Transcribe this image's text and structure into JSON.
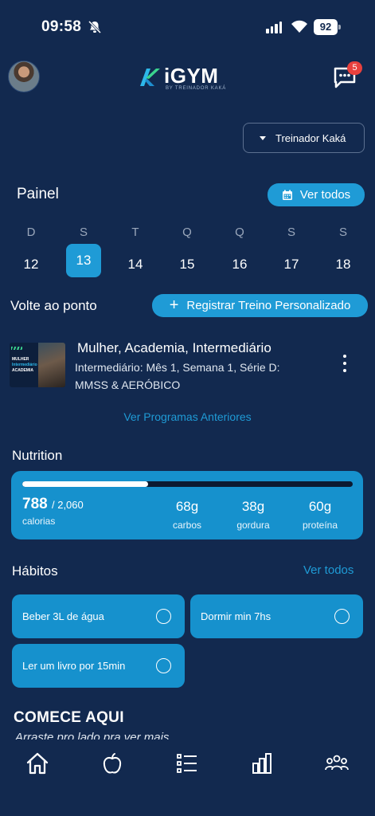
{
  "status_bar": {
    "time": "09:58",
    "battery": "92"
  },
  "header": {
    "logo_text": "iGYM",
    "logo_subtitle": "BY TREINADOR KAKÁ",
    "messages_badge": "5"
  },
  "trainer_select": {
    "selected": "Treinador Kaká"
  },
  "painel": {
    "title": "Painel",
    "ver_todos": "Ver todos",
    "days": [
      {
        "letter": "D",
        "num": "12"
      },
      {
        "letter": "S",
        "num": "13",
        "active": true
      },
      {
        "letter": "T",
        "num": "14"
      },
      {
        "letter": "Q",
        "num": "15"
      },
      {
        "letter": "Q",
        "num": "16"
      },
      {
        "letter": "S",
        "num": "17"
      },
      {
        "letter": "S",
        "num": "18"
      }
    ]
  },
  "volte": {
    "title": "Volte ao ponto",
    "register_button": "Registrar Treino Personalizado"
  },
  "program": {
    "thumb_line1": "MULHER",
    "thumb_line2": "Intermediário",
    "thumb_line3": "ACADEMIA",
    "title": "Mulher, Academia, Intermediário",
    "subtitle": "Intermediário: Mês 1, Semana 1, Série D: MMSS & AERÓBICO",
    "prev_link": "Ver Programas Anteriores"
  },
  "nutrition": {
    "title": "Nutrition",
    "calories": "788",
    "calories_goal": "/ 2,060",
    "calories_label": "calorias",
    "progress_fraction": 0.38,
    "macros": [
      {
        "value": "68g",
        "label": "carbos"
      },
      {
        "value": "38g",
        "label": "gordura"
      },
      {
        "value": "60g",
        "label": "proteína"
      }
    ]
  },
  "habits": {
    "title": "Hábitos",
    "ver_todos": "Ver todos",
    "items": [
      {
        "label": "Beber 3L de água"
      },
      {
        "label": "Dormir min 7hs"
      },
      {
        "label": "Ler um livro por 15min"
      }
    ]
  },
  "start": {
    "title": "COMECE AQUI",
    "subtitle": "Arraste pro lado pra ver mais"
  },
  "tabbar": {
    "tabs": [
      "home-icon",
      "apple-icon",
      "checklist-icon",
      "bar-chart-icon",
      "group-icon"
    ]
  },
  "colors": {
    "background": "#12294f",
    "accent": "#1f9bd6",
    "card": "#1691cd",
    "badge": "#e8413e"
  }
}
